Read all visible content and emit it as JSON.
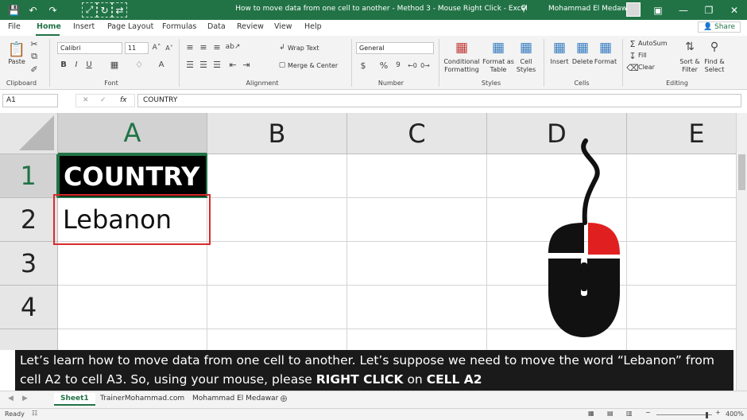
{
  "titlebar": {
    "title": "How to move data from one cell to another - Method 3 - Mouse Right Click  -  Excel",
    "user": "Mohammad El Medawar"
  },
  "tabs": [
    "File",
    "Home",
    "Insert",
    "Page Layout",
    "Formulas",
    "Data",
    "Review",
    "View",
    "Help"
  ],
  "share_label": "Share",
  "ribbon": {
    "clipboard": {
      "label": "Clipboard",
      "paste": "Paste"
    },
    "font": {
      "label": "Font",
      "name": "Calibri",
      "size": "11",
      "bold": "B",
      "italic": "I",
      "underline": "U"
    },
    "alignment": {
      "label": "Alignment",
      "wrap": "Wrap Text",
      "merge": "Merge & Center"
    },
    "number": {
      "label": "Number",
      "format": "General"
    },
    "styles": {
      "label": "Styles",
      "conditional": "Conditional Formatting",
      "format_table": "Format as Table",
      "cell_styles": "Cell Styles"
    },
    "cells": {
      "label": "Cells",
      "insert": "Insert",
      "delete": "Delete",
      "format": "Format"
    },
    "editing": {
      "label": "Editing",
      "autosum": "AutoSum",
      "fill": "Fill",
      "clear": "Clear",
      "sort": "Sort & Filter",
      "find": "Find & Select"
    }
  },
  "formula_bar": {
    "name_box": "A1",
    "fx": "fx",
    "content": "COUNTRY"
  },
  "columns": [
    "A",
    "B",
    "C",
    "D",
    "E"
  ],
  "rows": [
    "1",
    "2",
    "3",
    "4"
  ],
  "cells": {
    "A1": "COUNTRY",
    "A2": "Lebanon"
  },
  "caption": {
    "part1": "Let’s learn how to move data from one cell to another. Let’s suppose we need to move the word “Lebanon” from cell A2 to cell A3. So, using your mouse, please ",
    "bold1": "RIGHT CLICK",
    "part2": " on ",
    "bold2": "CELL A2"
  },
  "sheets": [
    "Sheet1",
    "TrainerMohammad.com",
    "Mohammad El Medawar"
  ],
  "status": {
    "ready": "Ready",
    "zoom": "400%"
  },
  "colors": {
    "excel_green": "#217346",
    "highlight_red": "#d92b2b",
    "mouse_button": "#e02020"
  }
}
